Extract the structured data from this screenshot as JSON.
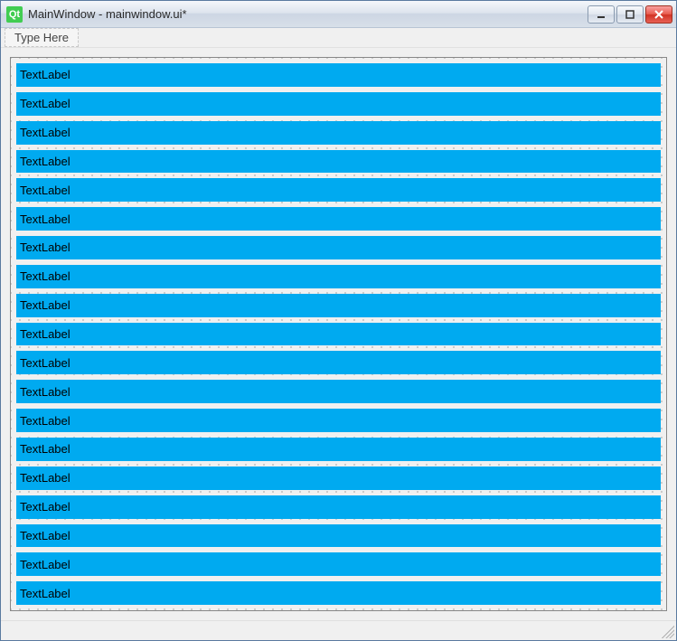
{
  "titlebar": {
    "icon_text": "Qt",
    "title": "MainWindow - mainwindow.ui*"
  },
  "menubar": {
    "placeholder": "Type Here"
  },
  "labels": [
    {
      "text": "TextLabel"
    },
    {
      "text": "TextLabel"
    },
    {
      "text": "TextLabel"
    },
    {
      "text": "TextLabel"
    },
    {
      "text": "TextLabel"
    },
    {
      "text": "TextLabel"
    },
    {
      "text": "TextLabel"
    },
    {
      "text": "TextLabel"
    },
    {
      "text": "TextLabel"
    },
    {
      "text": "TextLabel"
    },
    {
      "text": "TextLabel"
    },
    {
      "text": "TextLabel"
    },
    {
      "text": "TextLabel"
    },
    {
      "text": "TextLabel"
    },
    {
      "text": "TextLabel"
    },
    {
      "text": "TextLabel"
    },
    {
      "text": "TextLabel"
    },
    {
      "text": "TextLabel"
    },
    {
      "text": "TextLabel"
    }
  ],
  "colors": {
    "label_bg": "#00aaf0"
  }
}
